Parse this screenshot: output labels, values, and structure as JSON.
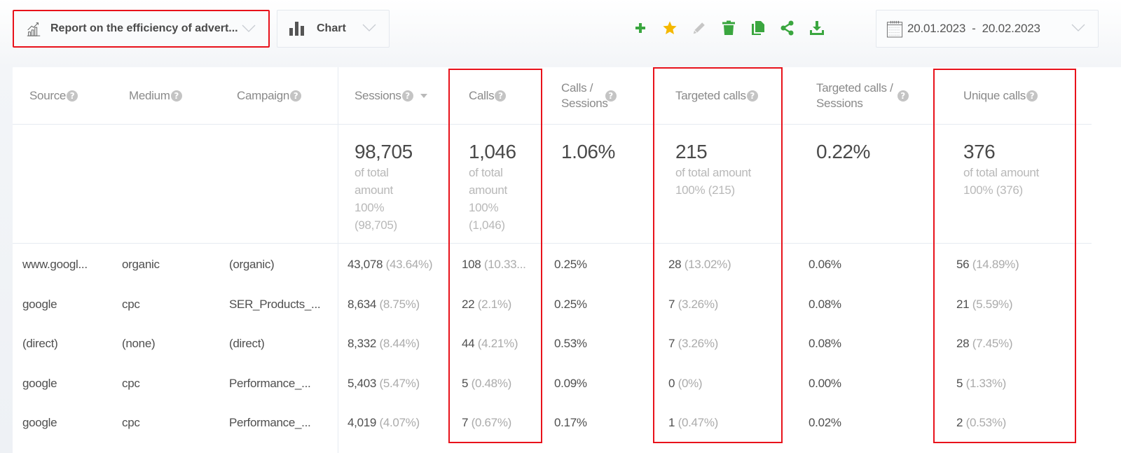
{
  "toolbar": {
    "report_select": {
      "label": "Report on the efficiency of advert...",
      "icon": "chart-growth-icon"
    },
    "view_select": {
      "label": "Chart",
      "icon": "bar-chart-icon"
    },
    "actions": [
      {
        "name": "add",
        "icon": "plus-icon",
        "color": "#3aa63f"
      },
      {
        "name": "favorite",
        "icon": "star-icon",
        "color": "#f5b800"
      },
      {
        "name": "edit",
        "icon": "pencil-icon",
        "color": "#c2c2c2"
      },
      {
        "name": "delete",
        "icon": "trash-icon",
        "color": "#3aa63f"
      },
      {
        "name": "copy",
        "icon": "copy-icon",
        "color": "#3aa63f"
      },
      {
        "name": "share",
        "icon": "share-icon",
        "color": "#3aa63f"
      },
      {
        "name": "download",
        "icon": "download-icon",
        "color": "#3aa63f"
      }
    ],
    "date_range": {
      "from": "20.01.2023",
      "separator": "-",
      "to": "20.02.2023",
      "label": "20.01.2023  -  20.02.2023",
      "icon": "calendar-icon"
    }
  },
  "table": {
    "columns": [
      {
        "key": "source",
        "label": "Source"
      },
      {
        "key": "medium",
        "label": "Medium"
      },
      {
        "key": "campaign",
        "label": "Campaign"
      },
      {
        "key": "sessions",
        "label": "Sessions",
        "sorted": "desc"
      },
      {
        "key": "calls",
        "label": "Calls"
      },
      {
        "key": "calls_sessions",
        "label_line1": "Calls /",
        "label_line2": "Sessions"
      },
      {
        "key": "targeted_calls",
        "label": "Targeted calls"
      },
      {
        "key": "targeted_calls_sessions",
        "label_line1": "Targeted calls /",
        "label_line2": "Sessions"
      },
      {
        "key": "unique_calls",
        "label": "Unique calls"
      }
    ],
    "totals": {
      "sessions": {
        "value": "98,705",
        "sub": [
          "of total",
          "amount",
          "100%",
          "(98,705)"
        ]
      },
      "calls": {
        "value": "1,046",
        "sub": [
          "of total",
          "amount",
          "100%",
          "(1,046)"
        ]
      },
      "calls_sessions": {
        "value": "1.06%"
      },
      "targeted_calls": {
        "value": "215",
        "sub": [
          "of total amount",
          "100% (215)"
        ]
      },
      "targeted_calls_sessions": {
        "value": "0.22%"
      },
      "unique_calls": {
        "value": "376",
        "sub": [
          "of total amount",
          "100% (376)"
        ]
      }
    },
    "rows": [
      {
        "source": "www.googl...",
        "medium": "organic",
        "campaign": "(organic)",
        "sessions": "43,078",
        "sessions_pct": "(43.64%)",
        "calls": "108",
        "calls_pct": "(10.33...",
        "calls_sessions": "0.25%",
        "targeted_calls": "28",
        "targeted_calls_pct": "(13.02%)",
        "targeted_calls_sessions": "0.06%",
        "unique_calls": "56",
        "unique_calls_pct": "(14.89%)"
      },
      {
        "source": "google",
        "medium": "cpc",
        "campaign": "SER_Products_...",
        "sessions": "8,634",
        "sessions_pct": "(8.75%)",
        "calls": "22",
        "calls_pct": "(2.1%)",
        "calls_sessions": "0.25%",
        "targeted_calls": "7",
        "targeted_calls_pct": "(3.26%)",
        "targeted_calls_sessions": "0.08%",
        "unique_calls": "21",
        "unique_calls_pct": "(5.59%)"
      },
      {
        "source": "(direct)",
        "medium": "(none)",
        "campaign": "(direct)",
        "sessions": "8,332",
        "sessions_pct": "(8.44%)",
        "calls": "44",
        "calls_pct": "(4.21%)",
        "calls_sessions": "0.53%",
        "targeted_calls": "7",
        "targeted_calls_pct": "(3.26%)",
        "targeted_calls_sessions": "0.08%",
        "unique_calls": "28",
        "unique_calls_pct": "(7.45%)"
      },
      {
        "source": "google",
        "medium": "cpc",
        "campaign": "Performance_...",
        "sessions": "5,403",
        "sessions_pct": "(5.47%)",
        "calls": "5",
        "calls_pct": "(0.48%)",
        "calls_sessions": "0.09%",
        "targeted_calls": "0",
        "targeted_calls_pct": "(0%)",
        "targeted_calls_sessions": "0.00%",
        "unique_calls": "5",
        "unique_calls_pct": "(1.33%)"
      },
      {
        "source": "google",
        "medium": "cpc",
        "campaign": "Performance_...",
        "sessions": "4,019",
        "sessions_pct": "(4.07%)",
        "calls": "7",
        "calls_pct": "(0.67%)",
        "calls_sessions": "0.17%",
        "targeted_calls": "1",
        "targeted_calls_pct": "(0.47%)",
        "targeted_calls_sessions": "0.02%",
        "unique_calls": "2",
        "unique_calls_pct": "(0.53%)"
      }
    ]
  },
  "highlight_color": "#e8121b"
}
